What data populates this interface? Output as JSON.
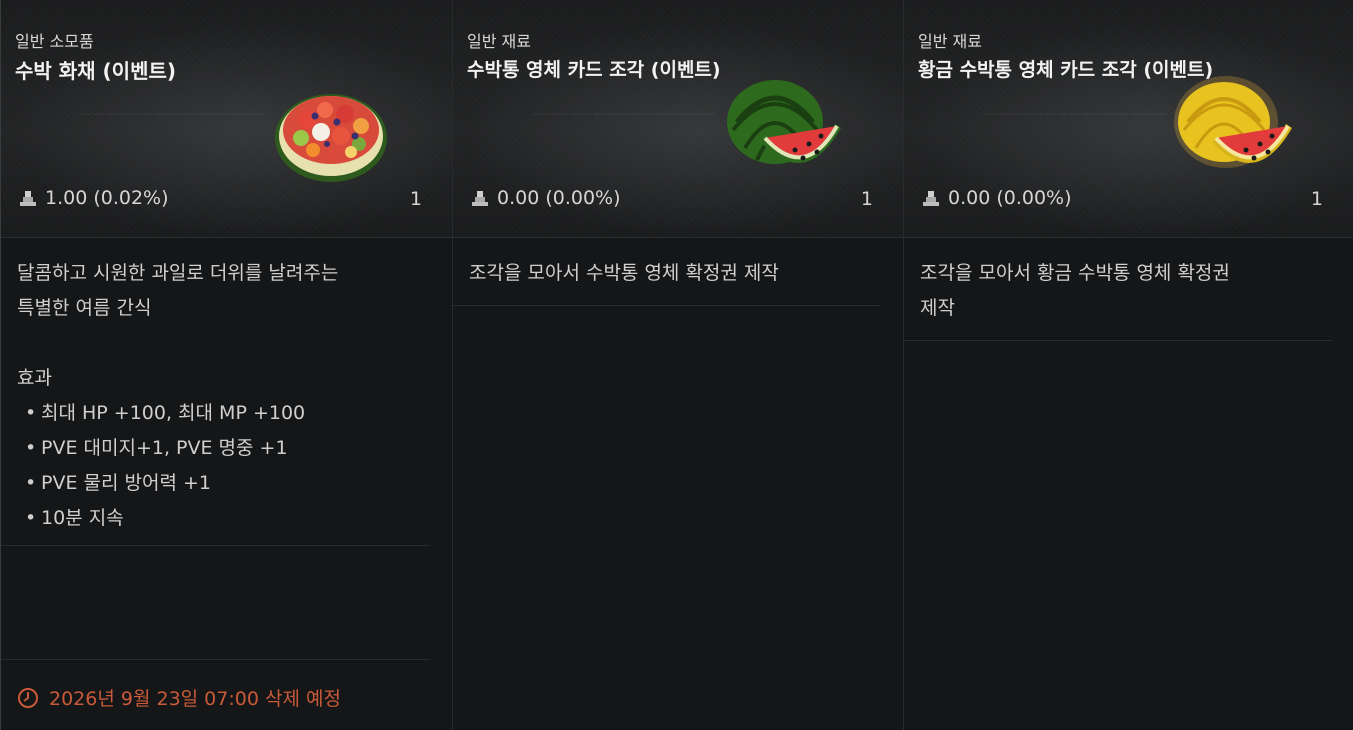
{
  "colors": {
    "background": "#141516",
    "card_background": "#151617",
    "text": "#cfcfcf",
    "title": "#f2f2f2",
    "expire": "#c85a3a"
  },
  "cards": [
    {
      "category": "일반 소모품",
      "name": "수박 화채 (이벤트)",
      "icon": "fruit-punch-bowl-icon",
      "price": "1.00 (0.02%)",
      "quantity": "1",
      "description_lines": [
        "달콤하고 시원한 과일로 더위를 날려주는",
        "특별한 여름 간식"
      ],
      "effects_title": "효과",
      "effects": [
        "최대 HP +100, 최대 MP +100",
        "PVE 대미지+1, PVE 명중 +1",
        "PVE 물리 방어력 +1",
        "10분 지속"
      ],
      "expire": "2026년 9월 23일 07:00 삭제 예정"
    },
    {
      "category": "일반 재료",
      "name": "수박통 영체 카드 조각 (이벤트)",
      "icon": "watermelon-icon",
      "price": "0.00 (0.00%)",
      "quantity": "1",
      "description_lines": [
        "조각을 모아서 수박통 영체 확정권 제작"
      ]
    },
    {
      "category": "일반 재료",
      "name": "황금 수박통 영체 카드 조각 (이벤트)",
      "icon": "golden-watermelon-icon",
      "price": "0.00 (0.00%)",
      "quantity": "1",
      "description_lines": [
        "조각을 모아서 황금 수박통 영체 확정권",
        "제작"
      ]
    }
  ]
}
